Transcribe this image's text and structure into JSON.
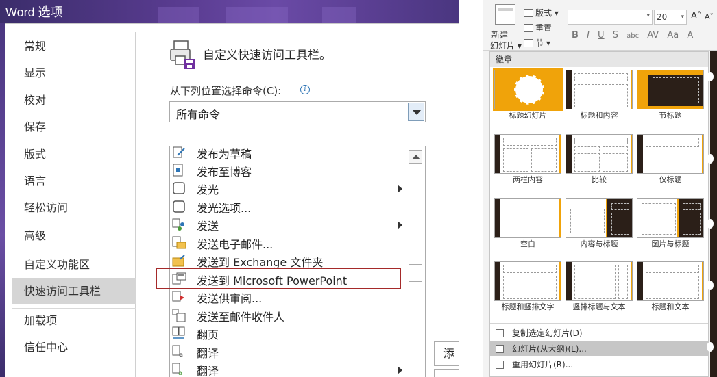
{
  "word": {
    "title": "Word 选项",
    "nav": [
      {
        "label": "常规",
        "selected": false
      },
      {
        "label": "显示",
        "selected": false
      },
      {
        "label": "校对",
        "selected": false
      },
      {
        "label": "保存",
        "selected": false
      },
      {
        "label": "版式",
        "selected": false
      },
      {
        "label": "语言",
        "selected": false
      },
      {
        "label": "轻松访问",
        "selected": false
      },
      {
        "label": "高级",
        "selected": false
      },
      {
        "label": "自定义功能区",
        "selected": false
      },
      {
        "label": "快速访问工具栏",
        "selected": true
      },
      {
        "label": "加载项",
        "selected": false
      },
      {
        "label": "信任中心",
        "selected": false
      }
    ],
    "heading": "自定义快速访问工具栏。",
    "choose_label": "从下列位置选择命令(C):",
    "info_glyph": "i",
    "choose_value": "所有命令",
    "commands": [
      {
        "label": "发布为草稿",
        "icon": "publish-draft-icon",
        "submenu": false
      },
      {
        "label": "发布至博客",
        "icon": "publish-blog-icon",
        "submenu": false
      },
      {
        "label": "发光",
        "icon": "glow-icon",
        "submenu": true
      },
      {
        "label": "发光选项...",
        "icon": "glow-options-icon",
        "submenu": false
      },
      {
        "label": "发送",
        "icon": "send-icon",
        "submenu": true
      },
      {
        "label": "发送电子邮件...",
        "icon": "send-email-icon",
        "submenu": false
      },
      {
        "label": "发送到 Exchange 文件夹",
        "icon": "exchange-folder-icon",
        "submenu": false
      },
      {
        "label": "发送到 Microsoft PowerPoint",
        "icon": "send-to-powerpoint-icon",
        "submenu": false,
        "highlighted": true
      },
      {
        "label": "发送供审阅...",
        "icon": "send-for-review-icon",
        "submenu": false
      },
      {
        "label": "发送至邮件收件人",
        "icon": "send-to-mail-recipient-icon",
        "submenu": false
      },
      {
        "label": "翻页",
        "icon": "page-turn-icon",
        "submenu": false
      },
      {
        "label": "翻译",
        "icon": "translate-icon",
        "submenu": false
      },
      {
        "label": "翻译",
        "icon": "translate-icon",
        "submenu": true
      }
    ],
    "add_button": "添"
  },
  "ppt": {
    "new_slide_line1": "新建",
    "new_slide_line2": "幻灯片",
    "layout_btn": "版式",
    "reset_btn": "重置",
    "section_btn": "节",
    "font_size": "20",
    "format_glyphs": [
      "B",
      "I",
      "U",
      "S",
      "abc",
      "AV",
      "Aa",
      "A"
    ],
    "grow_font": "A",
    "shrink_font": "A",
    "gallery_header": "徽章",
    "layouts": [
      {
        "label": "标题幻灯片",
        "selected": true
      },
      {
        "label": "标题和内容",
        "selected": false
      },
      {
        "label": "节标题",
        "selected": false
      },
      {
        "label": "两栏内容",
        "selected": false
      },
      {
        "label": "比较",
        "selected": false
      },
      {
        "label": "仅标题",
        "selected": false
      },
      {
        "label": "空白",
        "selected": false
      },
      {
        "label": "内容与标题",
        "selected": false
      },
      {
        "label": "图片与标题",
        "selected": false
      },
      {
        "label": "标题和竖排文字",
        "selected": false
      },
      {
        "label": "竖排标题与文本",
        "selected": false
      },
      {
        "label": "标题和文本",
        "selected": false
      }
    ],
    "menu": [
      {
        "label": "复制选定幻灯片(D)",
        "hover": false
      },
      {
        "label": "幻灯片(从大纲)(L)...",
        "hover": true
      },
      {
        "label": "重用幻灯片(R)...",
        "hover": false
      }
    ],
    "colors": {
      "accent": "#f0a30a",
      "dark": "#2b1f18"
    }
  }
}
